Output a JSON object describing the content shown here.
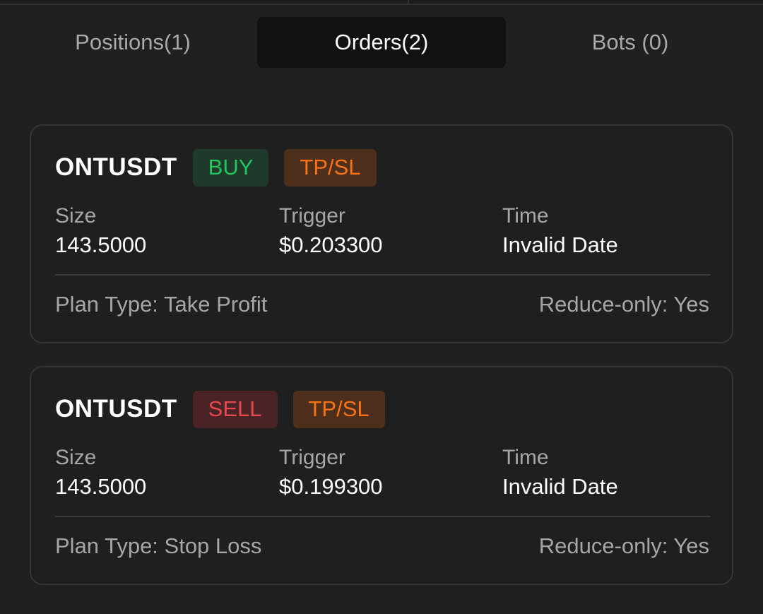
{
  "tabs": [
    {
      "label": "Positions(1)",
      "active": false
    },
    {
      "label": "Orders(2)",
      "active": true
    },
    {
      "label": "Bots (0)",
      "active": false
    }
  ],
  "orders": [
    {
      "symbol": "ONTUSDT",
      "side": "BUY",
      "type_badge": "TP/SL",
      "size_label": "Size",
      "size_value": "143.5000",
      "trigger_label": "Trigger",
      "trigger_value": "$0.203300",
      "time_label": "Time",
      "time_value": "Invalid Date",
      "plan_type": "Plan Type: Take Profit",
      "reduce_only": "Reduce-only: Yes"
    },
    {
      "symbol": "ONTUSDT",
      "side": "SELL",
      "type_badge": "TP/SL",
      "size_label": "Size",
      "size_value": "143.5000",
      "trigger_label": "Trigger",
      "trigger_value": "$0.199300",
      "time_label": "Time",
      "time_value": "Invalid Date",
      "plan_type": "Plan Type: Stop Loss",
      "reduce_only": "Reduce-only: Yes"
    }
  ],
  "colors": {
    "background": "#202020",
    "buy": "#22c55e",
    "sell": "#e5484d",
    "tpsl": "#f97316"
  }
}
